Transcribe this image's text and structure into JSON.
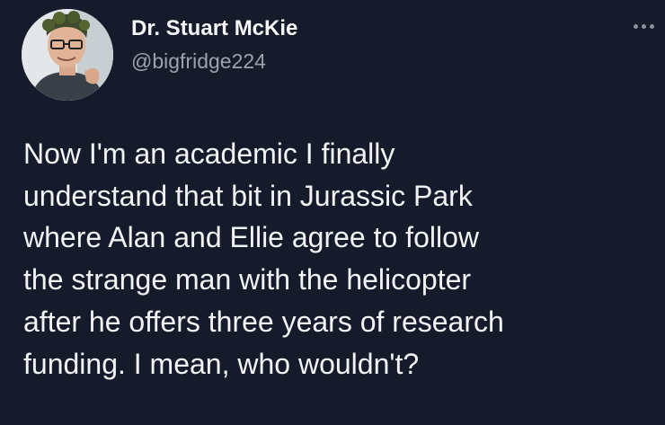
{
  "author": {
    "display_name": "Dr. Stuart McKie",
    "handle": "@bigfridge224",
    "avatar": "profile-photo"
  },
  "menu": {
    "icon": "more-options-icon"
  },
  "tweet": {
    "lines": [
      "Now I'm an academic I finally",
      "understand that bit in Jurassic Park",
      "where Alan and Ellie agree to follow",
      "the strange man with the helicopter",
      "after he offers three years of research",
      "funding. I mean, who wouldn't?"
    ]
  },
  "colors": {
    "background": "#151b2b",
    "text": "#f1f3f5",
    "secondary_text": "#9aa3ad"
  }
}
